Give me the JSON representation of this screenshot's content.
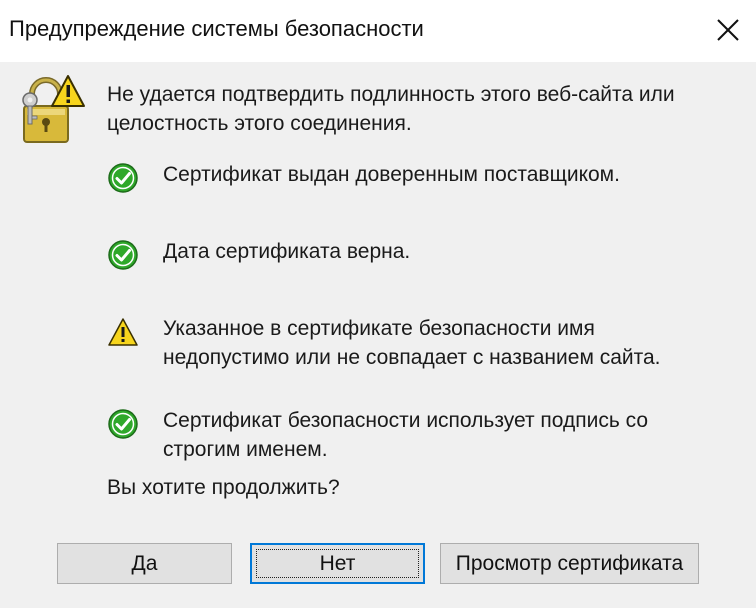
{
  "window": {
    "title": "Предупреждение системы безопасности"
  },
  "icons": {
    "header": "lock-warning-icon",
    "ok": "green-check-icon",
    "warn": "yellow-warning-icon",
    "close": "close-icon"
  },
  "intro_text": "Не удается подтвердить подлинность этого веб-сайта или целостность этого соединения.",
  "checks": [
    {
      "status": "ok",
      "text": "Сертификат выдан доверенным поставщиком."
    },
    {
      "status": "ok",
      "text": "Дата сертификата верна."
    },
    {
      "status": "warning",
      "text": "Указанное в сертификате безопасности имя недопустимо или не совпадает с названием сайта."
    },
    {
      "status": "ok",
      "text": "Сертификат безопасности использует подпись со строгим именем."
    }
  ],
  "question": "Вы хотите продолжить?",
  "buttons": {
    "yes": "Да",
    "no": "Нет",
    "view_certificate": "Просмотр сертификата"
  },
  "colors": {
    "accent": "#0078d7",
    "check_green": "#2fa82a",
    "warning_yellow": "#f7d51d"
  }
}
